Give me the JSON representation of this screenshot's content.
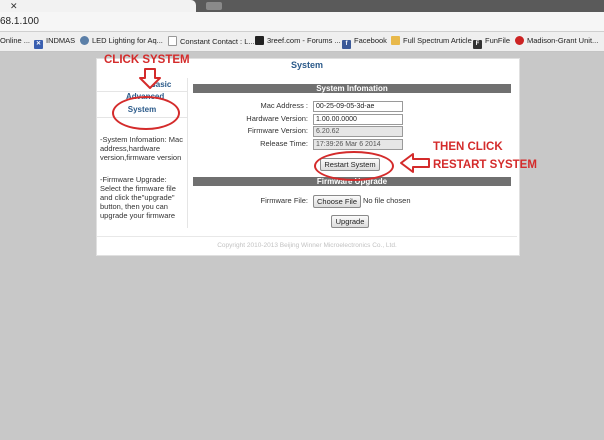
{
  "browser": {
    "url": "68.1.100",
    "bookmarks": [
      {
        "label": "Online ...",
        "icon": "none"
      },
      {
        "label": "INDMAS",
        "icon": "flag-icon"
      },
      {
        "label": "LED Lighting for Aq...",
        "icon": "globe-icon"
      },
      {
        "label": "Constant Contact : L...",
        "icon": "page-icon"
      },
      {
        "label": "3reef.com - Forums ...",
        "icon": "reef-icon"
      },
      {
        "label": "Facebook",
        "icon": "facebook-icon"
      },
      {
        "label": "Full Spectrum Article",
        "icon": "folder-icon"
      },
      {
        "label": "FunFile",
        "icon": "funfile-icon"
      },
      {
        "label": "Madison-Grant Unit...",
        "icon": "apple-icon"
      }
    ]
  },
  "page": {
    "heading": "System",
    "sidebar": {
      "basic": "Basic",
      "advanced": "Advanced",
      "system": "System",
      "desc_system": "-System Infomation: Mac address,hardware version,firmware version",
      "desc_firmware": "-Firmware Upgrade: Select the firmware file and click the\"upgrade\" button, then you can upgrade your firmware"
    },
    "system_info": {
      "title": "System Infomation",
      "mac_label": "Mac Address :",
      "mac_value": "00-25-09-05-3d-ae",
      "hw_label": "Hardware Version:",
      "hw_value": "1.00.00.0000",
      "fw_label": "Firmware Version:",
      "fw_value": "6.20.62",
      "release_label": "Release Time:",
      "release_value": "17:39:26 Mar  6 2014",
      "restart_label": "Restart System"
    },
    "firmware": {
      "title": "Firmware Upgrade",
      "file_label": "Firmware File:",
      "choose_label": "Choose File",
      "no_file": "No file chosen",
      "upgrade_label": "Upgrade"
    },
    "copyright": "Copyright 2010-2013 Beijing Winner Microelectronics Co., Ltd."
  },
  "annotations": {
    "click_system": "CLICK SYSTEM",
    "then_click_1": "THEN CLICK",
    "then_click_2": "RESTART SYSTEM",
    "color": "#d42b2b"
  }
}
